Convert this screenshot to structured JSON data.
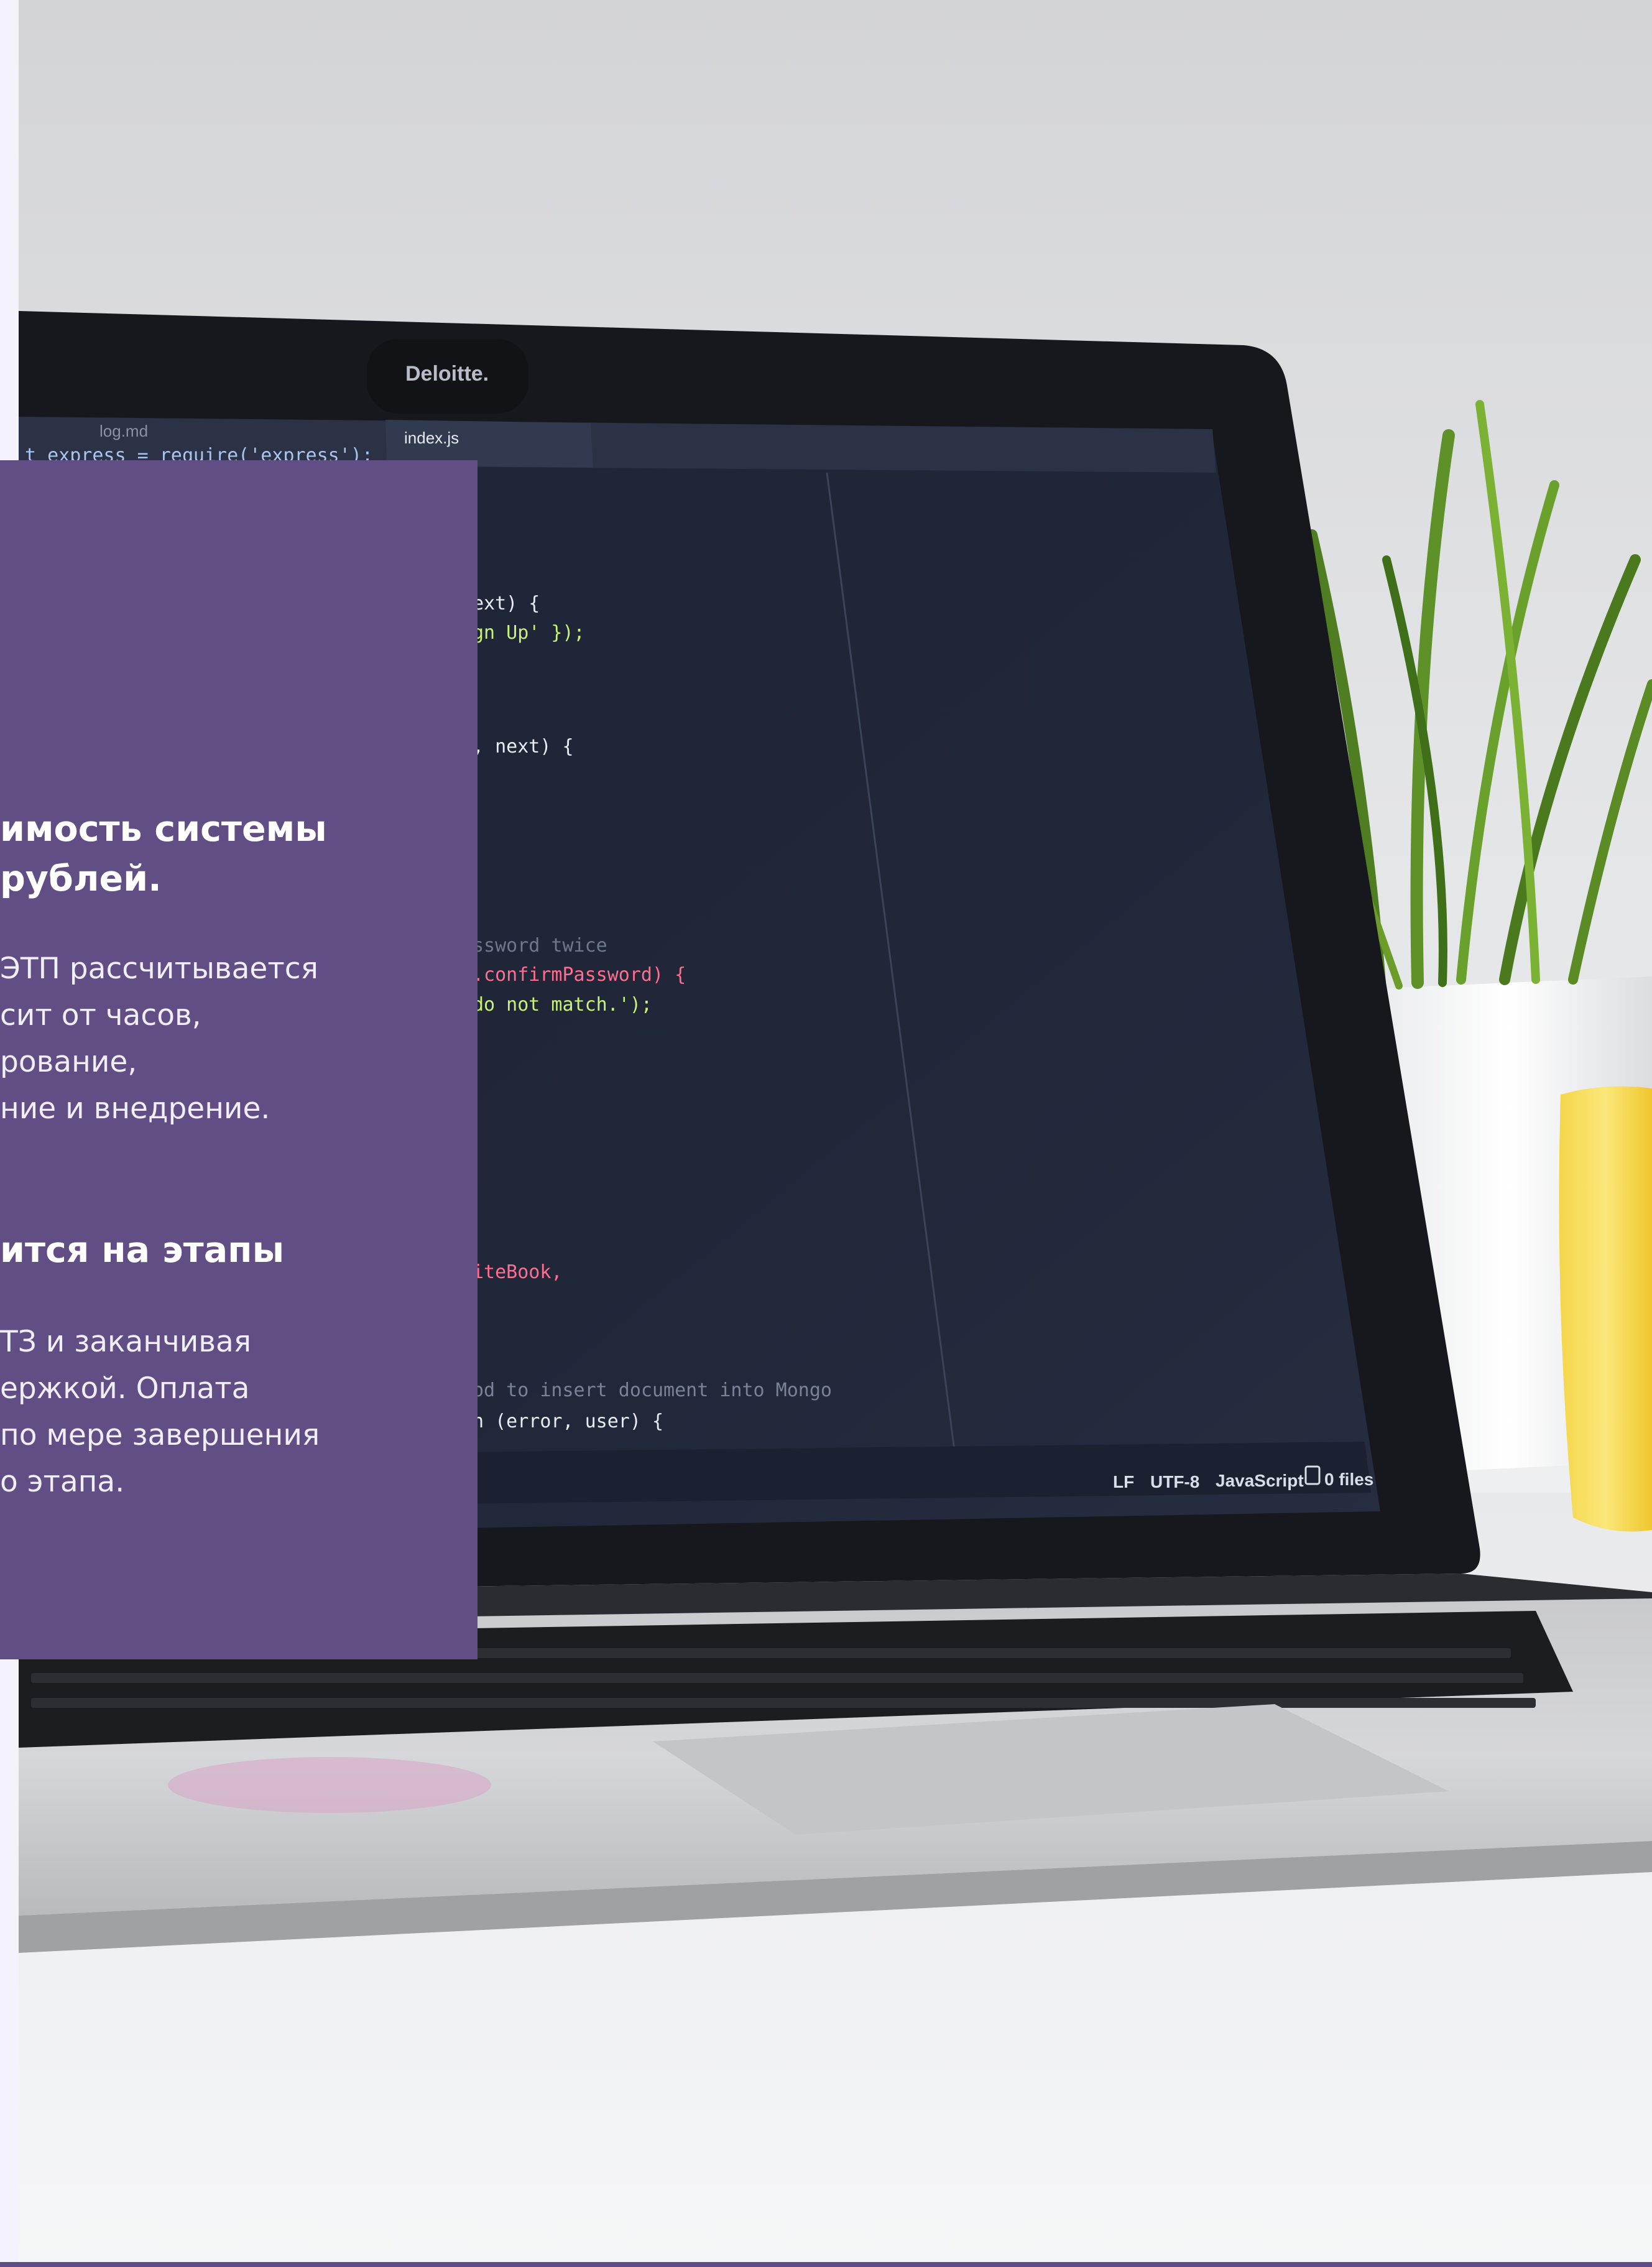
{
  "photo": {
    "laptop_brand": "Deloitte.",
    "editor_tabs": [
      "log.md",
      "index.js"
    ],
    "code_lines": [
      "t express = require('express');",
      "ext) {",
      "gn Up' });",
      ", next) {",
      "ssword twice",
      ".confirmPassword) {",
      "do not match.');",
      "iteBook,",
      "od to insert document into Mongo",
      "n (error, user) {"
    ],
    "status_bar": {
      "line_ending": "LF",
      "encoding": "UTF-8",
      "language": "JavaScript",
      "files": "0 files"
    }
  },
  "panel": {
    "heading1": [
      "имость системы",
      "рублей."
    ],
    "paragraph1": [
      "ЭТП рассчитывается",
      "сит от часов,",
      "рование,",
      "ние и внедрение."
    ],
    "heading2": [
      "ится на этапы"
    ],
    "paragraph2": [
      "ТЗ и заканчивая",
      "ержкой. Оплата",
      "по мере завершения",
      "о этапа."
    ]
  },
  "colors": {
    "panel_background": "#604e84",
    "panel_text": "#ffffff",
    "accent_line": "#5f4e85"
  }
}
